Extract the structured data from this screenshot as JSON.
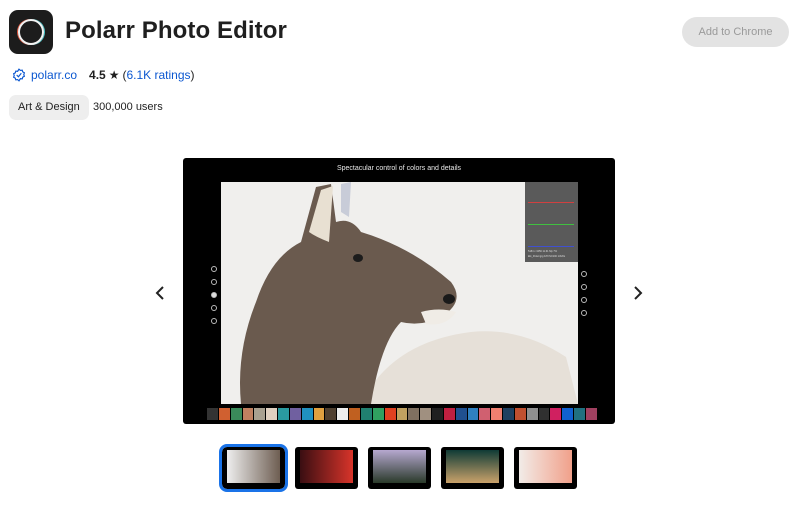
{
  "app": {
    "title": "Polarr Photo Editor",
    "icon": "polarr-ring-icon",
    "install_button": "Add to Chrome"
  },
  "meta": {
    "publisher": "polarr.co",
    "publisher_icon": "verified-badge-icon",
    "rating": "4.5",
    "star": "★",
    "ratings_count": "6.1K ratings",
    "open_paren": "(",
    "close_paren": ")",
    "category": "Art & Design",
    "users": "300,000 users"
  },
  "carousel": {
    "prev_icon": "chevron-left-icon",
    "next_icon": "chevron-right-icon",
    "active_index": 0,
    "screenshot_caption": "Spectacular control of colors and details",
    "histogram_info_1": "5184 x 3456        11.61 Mp        7%",
    "histogram_info_2": "Elk_Polarr.jpg  F/8 ISO100 1/320s",
    "thumbnails": [
      {
        "label": "Elk photo editing",
        "colors": [
          "#eeeeee",
          "#6e5e52"
        ]
      },
      {
        "label": "Red portrait",
        "colors": [
          "#3a0e12",
          "#d8342a"
        ]
      },
      {
        "label": "Palm trees purple sky",
        "colors": [
          "#b6a8d0",
          "#2a3a2a"
        ]
      },
      {
        "label": "Person in doorway",
        "colors": [
          "#0f3b36",
          "#caa26a"
        ]
      },
      {
        "label": "Pink flowers",
        "colors": [
          "#f2ece8",
          "#f1a08a"
        ]
      }
    ]
  },
  "colors": {
    "accent": "#0b57d0",
    "thumb_active": "#1a73e8",
    "button_bg": "#e3e3e3",
    "button_text": "#9a9a9a"
  }
}
